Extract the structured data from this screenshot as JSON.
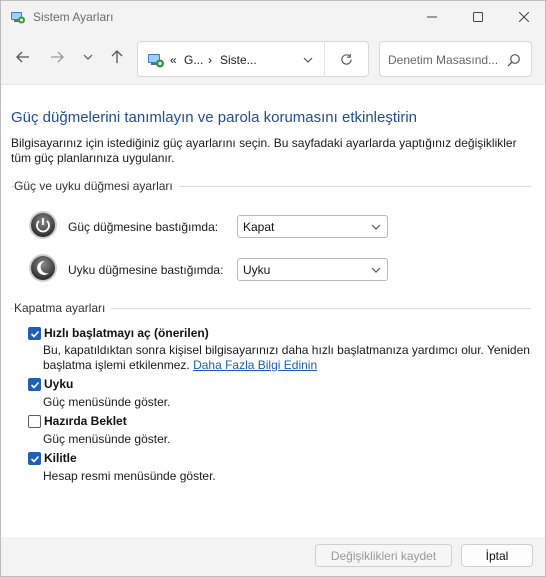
{
  "window": {
    "title": "Sistem Ayarları"
  },
  "nav": {
    "address_prefix": "«",
    "address_part1": "G...",
    "address_separator": "›",
    "address_part2": "Siste...",
    "search_placeholder": "Denetim Masasınd..."
  },
  "page": {
    "heading": "Güç düğmelerini tanımlayın ve parola korumasını etkinleştirin",
    "description": "Bilgisayarınız için istediğiniz güç ayarlarını seçin. Bu sayfadaki ayarlarda yaptığınız değişiklikler tüm güç planlarınıza uygulanır."
  },
  "power_section": {
    "title": "Güç ve uyku düğmesi ayarları",
    "rows": [
      {
        "label": "Güç düğmesine bastığımda:",
        "value": "Kapat",
        "icon": "power-button-icon"
      },
      {
        "label": "Uyku düğmesine bastığımda:",
        "value": "Uyku",
        "icon": "sleep-button-icon"
      }
    ]
  },
  "shutdown_section": {
    "title": "Kapatma ayarları",
    "options": [
      {
        "label": "Hızlı başlatmayı aç (önerilen)",
        "checked": true,
        "description": "Bu, kapatıldıktan sonra kişisel bilgisayarınızı daha hızlı başlatmanıza yardımcı olur. Yeniden başlatma işlemi etkilenmez.",
        "link": "Daha Fazla Bilgi Edinin"
      },
      {
        "label": "Uyku",
        "checked": true,
        "description": "Güç menüsünde göster."
      },
      {
        "label": "Hazırda Beklet",
        "checked": false,
        "description": "Güç menüsünde göster."
      },
      {
        "label": "Kilitle",
        "checked": true,
        "description": "Hesap resmi menüsünde göster."
      }
    ]
  },
  "footer": {
    "save_label": "Değişiklikleri kaydet",
    "cancel_label": "İptal"
  },
  "colors": {
    "accent": "#1f5fb4",
    "heading": "#1f4e96",
    "link": "#1a5fb4",
    "chrome": "#f3f3f3"
  }
}
